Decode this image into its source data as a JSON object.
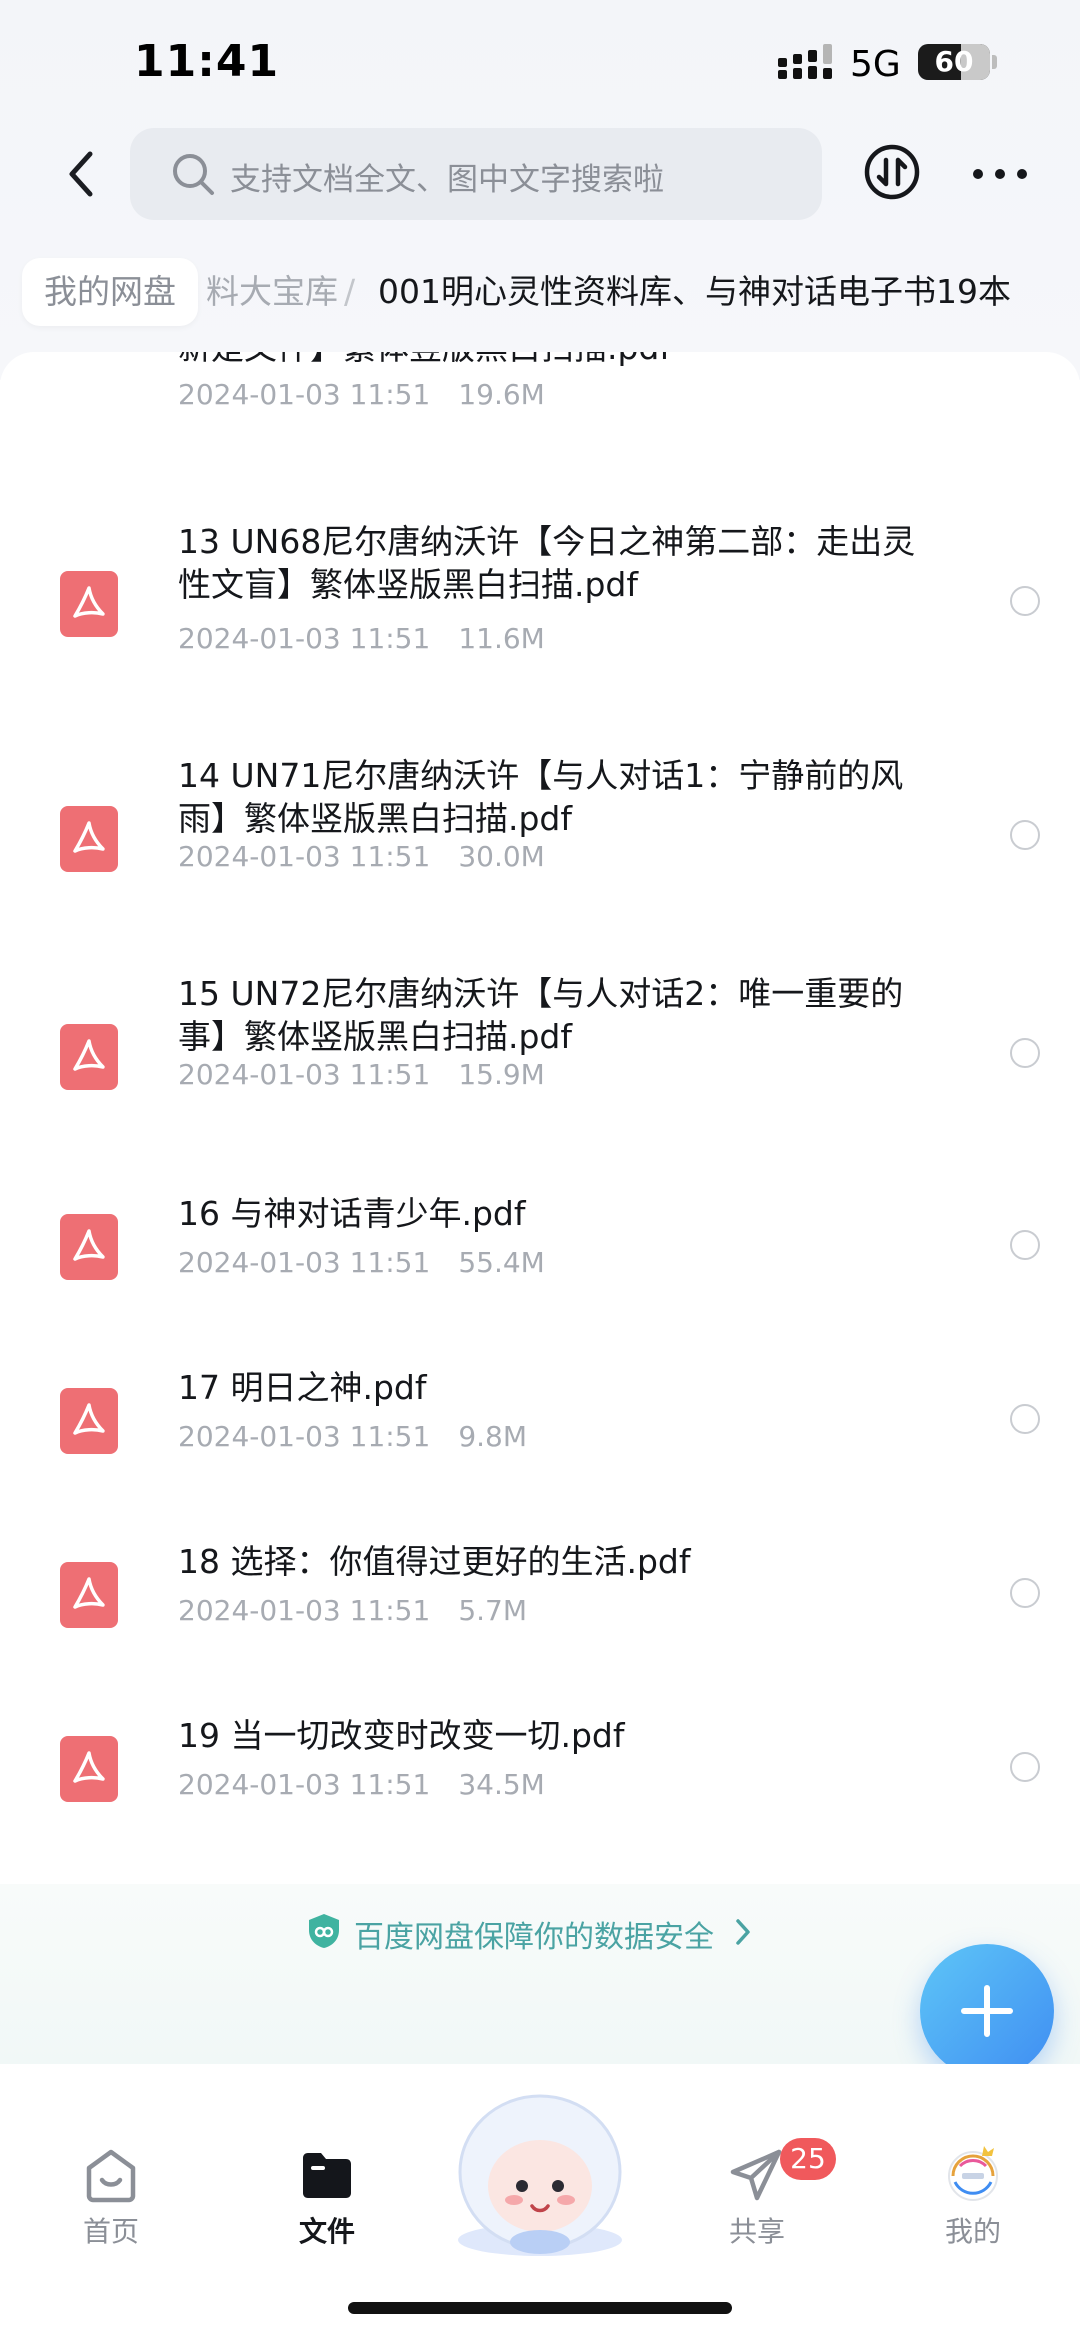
{
  "status_bar": {
    "time": "11:41",
    "network": "5G",
    "battery": "60",
    "battery_level_percent": 60
  },
  "header": {
    "search_placeholder": "支持文档全文、图中文字搜索啦"
  },
  "breadcrumb": {
    "root": "我的网盘",
    "middle": "料大宝库",
    "separator": "/",
    "current": "001明心灵性资料库、与神对话电子书19本"
  },
  "files": [
    {
      "name": "新是文件】繁体竖版黑白扫描.pdf",
      "date": "2024-01-03 11:51",
      "size": "19.6M"
    },
    {
      "name": "13 UN68尼尔唐纳沃许【今日之神第二部：走出灵性文盲】繁体竖版黑白扫描.pdf",
      "date": "2024-01-03 11:51",
      "size": "11.6M"
    },
    {
      "name": "14 UN71尼尔唐纳沃许【与人对话1：宁静前的风雨】繁体竖版黑白扫描.pdf",
      "date": "2024-01-03 11:51",
      "size": "30.0M"
    },
    {
      "name": "15 UN72尼尔唐纳沃许【与人对话2：唯一重要的事】繁体竖版黑白扫描.pdf",
      "date": "2024-01-03 11:51",
      "size": "15.9M"
    },
    {
      "name": "16 与神对话青少年.pdf",
      "date": "2024-01-03 11:51",
      "size": "55.4M"
    },
    {
      "name": "17 明日之神.pdf",
      "date": "2024-01-03 11:51",
      "size": "9.8M"
    },
    {
      "name": "18 选择：你值得过更好的生活.pdf",
      "date": "2024-01-03 11:51",
      "size": "5.7M"
    },
    {
      "name": "19 当一切改变时改变一切.pdf",
      "date": "2024-01-03 11:51",
      "size": "34.5M"
    }
  ],
  "safety_banner": {
    "text": "百度网盘保障你的数据安全"
  },
  "tabs": [
    {
      "label": "首页",
      "icon": "home-icon"
    },
    {
      "label": "文件",
      "icon": "folder-icon",
      "active": true
    },
    {
      "label": "共享",
      "icon": "paper-plane-icon",
      "badge": "25"
    },
    {
      "label": "我的",
      "icon": "avatar-icon"
    }
  ],
  "colors": {
    "accent": "#3f8df2",
    "pdf": "#ee6f74",
    "badge": "#f0595c",
    "safe": "#4aa3a3"
  }
}
